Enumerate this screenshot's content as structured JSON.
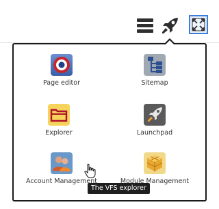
{
  "toolbar": {
    "menu_icon": "hamburger-menu-icon",
    "launch_icon": "rocket-icon",
    "expand_icon": "expand-arrows-icon"
  },
  "menu": {
    "items": [
      {
        "label": "Page editor",
        "icon": "target-roundel-icon"
      },
      {
        "label": "Sitemap",
        "icon": "sitemap-tree-icon"
      },
      {
        "label": "Explorer",
        "icon": "folder-icon"
      },
      {
        "label": "Launchpad",
        "icon": "rocket-icon"
      },
      {
        "label": "Account Management",
        "icon": "users-icon"
      },
      {
        "label": "Module Management",
        "icon": "module-cube-icon"
      }
    ]
  },
  "tooltip": {
    "text": "The VFS explorer"
  },
  "colors": {
    "accent": "#3b7dd8",
    "panel_border": "#1a1a1a"
  }
}
